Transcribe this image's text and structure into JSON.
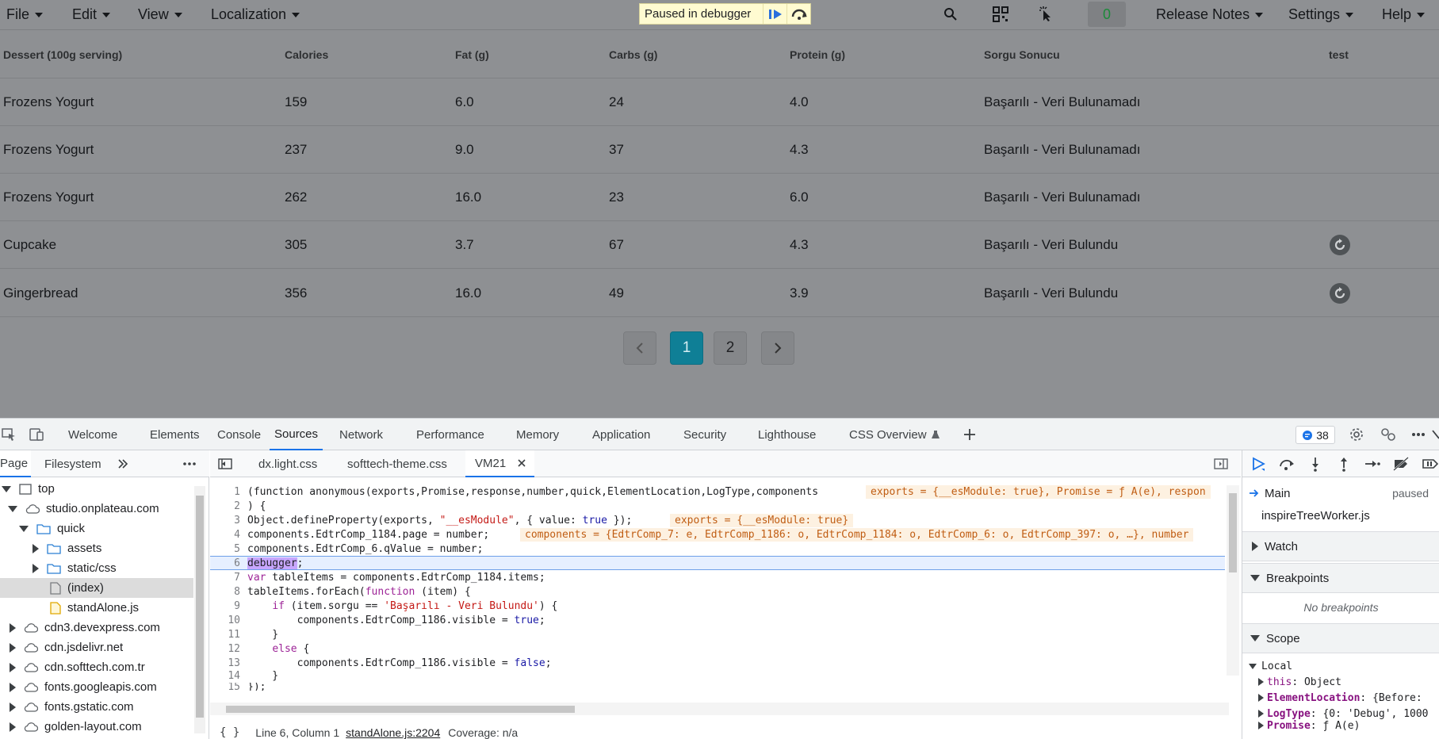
{
  "menubar": {
    "items": [
      "File",
      "Edit",
      "View",
      "Localization"
    ],
    "right_items": [
      "Release Notes",
      "Settings",
      "Help"
    ],
    "counter": "0"
  },
  "debugger_banner": {
    "text": "Paused in debugger"
  },
  "table": {
    "columns": [
      "Dessert (100g serving)",
      "Calories",
      "Fat (g)",
      "Carbs (g)",
      "Protein (g)",
      "Sorgu Sonucu",
      "test"
    ],
    "rows": [
      [
        "Frozens Yogurt",
        "159",
        "6.0",
        "24",
        "4.0",
        "Başarılı - Veri Bulunamadı",
        ""
      ],
      [
        "Frozens Yogurt",
        "237",
        "9.0",
        "37",
        "4.3",
        "Başarılı - Veri Bulunamadı",
        ""
      ],
      [
        "Frozens Yogurt",
        "262",
        "16.0",
        "23",
        "6.0",
        "Başarılı - Veri Bulunamadı",
        ""
      ],
      [
        "Cupcake",
        "305",
        "3.7",
        "67",
        "4.3",
        "Başarılı - Veri Bulundu",
        "refresh-icon"
      ],
      [
        "Gingerbread",
        "356",
        "16.0",
        "49",
        "3.9",
        "Başarılı - Veri Bulundu",
        "refresh-icon"
      ]
    ]
  },
  "pagination": {
    "pages": [
      "1",
      "2"
    ],
    "current": "1"
  },
  "devtools": {
    "tabs": [
      "Welcome",
      "Elements",
      "Console",
      "Sources",
      "Network",
      "Performance",
      "Memory",
      "Application",
      "Security",
      "Lighthouse",
      "CSS Overview"
    ],
    "active_tab": "Sources",
    "issues_count": "38",
    "navigator": {
      "tabs": [
        "Page",
        "Filesystem"
      ],
      "tree": [
        {
          "label": "top",
          "depth": 0,
          "icon": "frame-icon",
          "expanded": true
        },
        {
          "label": "studio.onplateau.com",
          "depth": 1,
          "icon": "cloud-icon",
          "expanded": true
        },
        {
          "label": "quick",
          "depth": 2,
          "icon": "folder-icon",
          "expanded": true
        },
        {
          "label": "assets",
          "depth": 3,
          "icon": "folder-icon",
          "expanded": false
        },
        {
          "label": "static/css",
          "depth": 3,
          "icon": "folder-icon",
          "expanded": false
        },
        {
          "label": "(index)",
          "depth": 3,
          "icon": "file-icon",
          "selected": true
        },
        {
          "label": "standAlone.js",
          "depth": 3,
          "icon": "js-file-icon"
        },
        {
          "label": "cdn3.devexpress.com",
          "depth": 1,
          "icon": "cloud-icon",
          "expanded": false
        },
        {
          "label": "cdn.jsdelivr.net",
          "depth": 1,
          "icon": "cloud-icon",
          "expanded": false
        },
        {
          "label": "cdn.softtech.com.tr",
          "depth": 1,
          "icon": "cloud-icon",
          "expanded": false
        },
        {
          "label": "fonts.googleapis.com",
          "depth": 1,
          "icon": "cloud-icon",
          "expanded": false
        },
        {
          "label": "fonts.gstatic.com",
          "depth": 1,
          "icon": "cloud-icon",
          "expanded": false
        },
        {
          "label": "golden-layout.com",
          "depth": 1,
          "icon": "cloud-icon",
          "expanded": false
        }
      ]
    },
    "editor": {
      "tabs": [
        "dx.light.css",
        "softtech-theme.css",
        "VM21"
      ],
      "active_tab": "VM21",
      "lines": [
        "(function anonymous(exports,Promise,response,number,quick,ElementLocation,LogType,components",
        ") {",
        "Object.defineProperty(exports, \"__esModule\", { value: true });",
        "components.EdtrComp_1184.page = number;",
        "components.EdtrComp_6.qValue = number;",
        "debugger;",
        "var tableItems = components.EdtrComp_1184.items;",
        "tableItems.forEach(function (item) {",
        "    if (item.sorgu == 'Başarılı - Veri Bulundu') {",
        "        components.EdtrComp_1186.visible = true;",
        "    }",
        "    else {",
        "        components.EdtrComp_1186.visible = false;",
        "    }",
        "});"
      ],
      "inline_values": {
        "line1": "exports = {__esModule: true}, Promise = ƒ A(e), respon",
        "line3": "exports = {__esModule: true}",
        "line4": "components = {EdtrComp_7: e, EdtrComp_1186: o, EdtrComp_1184: o, EdtrComp_6: o, EdtrComp_397: o, …}, number"
      },
      "status": {
        "braces": "{ }",
        "position": "Line 6, Column 1",
        "source_link": "standAlone.js:2204",
        "coverage": "Coverage: n/a"
      }
    },
    "debugger": {
      "threads": [
        {
          "name": "Main",
          "state": "paused"
        },
        {
          "name": "inspireTreeWorker.js",
          "state": ""
        }
      ],
      "sections": [
        "Watch",
        "Breakpoints",
        "Scope"
      ],
      "no_breakpoints": "No breakpoints",
      "scope_local": "Local",
      "scope_items": [
        {
          "key": "this",
          "value": "Object"
        },
        {
          "key": "ElementLocation",
          "value": "{Before:"
        },
        {
          "key": "LogType",
          "value": "{0: 'Debug', 1000"
        },
        {
          "key": "Promise",
          "value": "ƒ A(e)"
        }
      ]
    }
  }
}
